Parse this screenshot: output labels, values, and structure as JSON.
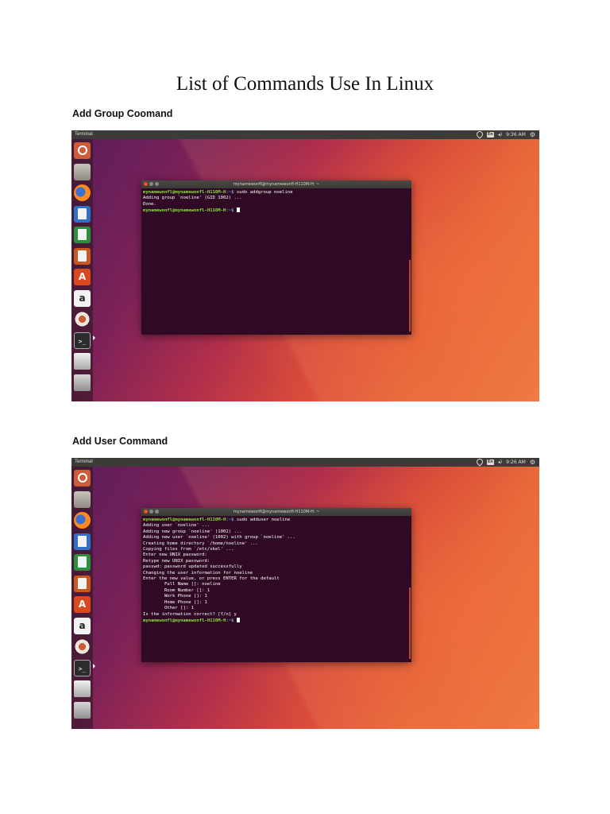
{
  "document": {
    "title": "List of Commands Use In Linux",
    "sections": [
      {
        "heading": "Add Group Coomand",
        "screenshot": {
          "topbar": {
            "app_name": "Terminal",
            "keyboard_layout": "En",
            "time": "9:36 AM"
          },
          "terminal": {
            "window_title": "mynamewonfl@mynamewonfl-H110M-H: ~",
            "lines": [
              {
                "prompt_user": "mynamewonfl@mynamewonfl-H110M-H",
                "prompt_path": ":~$",
                "command": " sudo addgroup noeline"
              },
              {
                "output": "Adding group `noeline' (GID 1002) ..."
              },
              {
                "output": "Done."
              },
              {
                "prompt_user": "mynamewonfl@mynamewonfl-H110M-H",
                "prompt_path": ":~$",
                "command": " ",
                "cursor": true
              }
            ]
          }
        }
      },
      {
        "heading": "Add User Command",
        "screenshot": {
          "topbar": {
            "app_name": "Terminal",
            "keyboard_layout": "En",
            "time": "9:26 AM"
          },
          "terminal": {
            "window_title": "mynamewonfl@mynamewonfl-H110M-H: ~",
            "lines": [
              {
                "prompt_user": "mynamewonfl@mynamewonfl-H110M-H",
                "prompt_path": ":~$",
                "command": " sudo adduser noeline"
              },
              {
                "output": "Adding user `noeline' ..."
              },
              {
                "output": "Adding new group `noeline' (1002) ..."
              },
              {
                "output": "Adding new user `noeline' (1002) with group `noeline' ..."
              },
              {
                "output": "Creating home directory `/home/noeline' ..."
              },
              {
                "output": "Copying files from `/etc/skel' ..."
              },
              {
                "output": "Enter new UNIX password:"
              },
              {
                "output": "Retype new UNIX password:"
              },
              {
                "output": "passwd: password updated successfully"
              },
              {
                "output": "Changing the user information for noeline"
              },
              {
                "output": "Enter the new value, or press ENTER for the default"
              },
              {
                "output": "        Full Name []: noeline"
              },
              {
                "output": "        Room Number []: 1"
              },
              {
                "output": "        Work Phone []: 1"
              },
              {
                "output": "        Home Phone []: 1"
              },
              {
                "output": "        Other []: 1"
              },
              {
                "output": "Is the information correct? [Y/n] y"
              },
              {
                "prompt_user": "mynamewonfl@mynamewonfl-H110M-H",
                "prompt_path": ":~$",
                "command": " ",
                "cursor": true
              }
            ]
          }
        }
      }
    ],
    "launcher_icons": [
      "ubuntu-icon",
      "files-icon",
      "firefox-icon",
      "writer-icon",
      "calc-icon",
      "impress-icon",
      "software-center-icon",
      "amazon-icon",
      "settings-icon",
      "terminal-icon",
      "drive-icon",
      "trash-icon"
    ],
    "launcher_glyphs": {
      "software-center-icon": "A",
      "amazon-icon": "a",
      "terminal-icon": ">_"
    }
  }
}
